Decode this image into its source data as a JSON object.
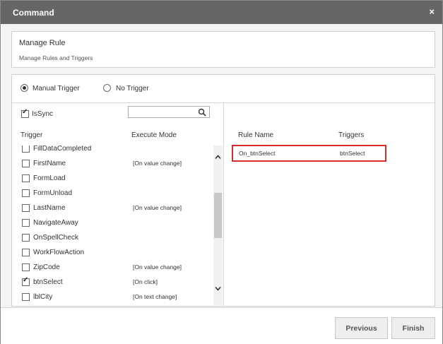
{
  "dialog": {
    "title": "Command",
    "close_glyph": "×"
  },
  "rule_panel": {
    "title": "Manage Rule",
    "subtitle": "Manage Rules and Triggers"
  },
  "radios": [
    {
      "label": "Manual Trigger",
      "checked": true
    },
    {
      "label": "No Trigger",
      "checked": false
    }
  ],
  "issync": {
    "label": "IsSync",
    "checked": true
  },
  "search": {
    "value": "",
    "placeholder": ""
  },
  "trigger_headers": {
    "trigger": "Trigger",
    "mode": "Execute Mode"
  },
  "triggers": [
    {
      "name": "FillDataCompleted",
      "mode": "",
      "checked": false
    },
    {
      "name": "FirstName",
      "mode": "[On value change]",
      "checked": false
    },
    {
      "name": "FormLoad",
      "mode": "",
      "checked": false
    },
    {
      "name": "FormUnload",
      "mode": "",
      "checked": false
    },
    {
      "name": "LastName",
      "mode": "[On value change]",
      "checked": false
    },
    {
      "name": "NavigateAway",
      "mode": "",
      "checked": false
    },
    {
      "name": "OnSpellCheck",
      "mode": "",
      "checked": false
    },
    {
      "name": "WorkFlowAction",
      "mode": "",
      "checked": false
    },
    {
      "name": "ZipCode",
      "mode": "[On value change]",
      "checked": false
    },
    {
      "name": "btnSelect",
      "mode": "[On click]",
      "checked": true
    },
    {
      "name": "lblCity",
      "mode": "[On text change]",
      "checked": false
    }
  ],
  "rules_headers": {
    "name": "Rule Name",
    "triggers": "Triggers"
  },
  "rules": [
    {
      "name": "On_btnSelect",
      "triggers": "btnSelect"
    }
  ],
  "buttons": {
    "previous": "Previous",
    "finish": "Finish"
  },
  "colors": {
    "titlebar": "#666666",
    "highlight": "#d42a2a"
  },
  "icons": {
    "search": "search-icon",
    "close": "close-icon",
    "scroll_up": "chevron-up-icon",
    "scroll_down": "chevron-down-icon"
  }
}
